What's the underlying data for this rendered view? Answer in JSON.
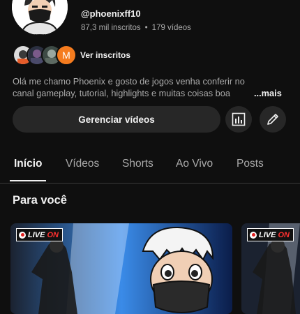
{
  "channel": {
    "handle": "@phoenixff10",
    "subscribers": "87,3 mil inscritos",
    "separator": "•",
    "videos": "179 vídeos",
    "sub_initial": "M",
    "see_subscribers": "Ver inscritos",
    "description_line1": "Olá me chamo Phoenix e gosto de jogos venha conferir no",
    "description_line2": "canal gameplay, tutorial, highlights e muitas coisas boa",
    "description_more": "...mais"
  },
  "actions": {
    "manage_videos": "Gerenciar vídeos",
    "analytics_icon": "bar-chart-icon",
    "edit_icon": "pencil-icon"
  },
  "tabs": [
    {
      "label": "Início",
      "active": true
    },
    {
      "label": "Vídeos",
      "active": false
    },
    {
      "label": "Shorts",
      "active": false
    },
    {
      "label": "Ao Vivo",
      "active": false
    },
    {
      "label": "Posts",
      "active": false
    }
  ],
  "section": {
    "title": "Para você"
  },
  "thumbnails": [
    {
      "badge_live": "LIVE",
      "badge_on": "ON"
    },
    {
      "badge_live": "LIVE",
      "badge_on": "ON"
    }
  ],
  "colors": {
    "background": "#0f0f0f",
    "button": "#272727",
    "secondary_text": "#aaaaaa",
    "sub_badge": "#f57c1f",
    "live_on": "#ff3030"
  }
}
